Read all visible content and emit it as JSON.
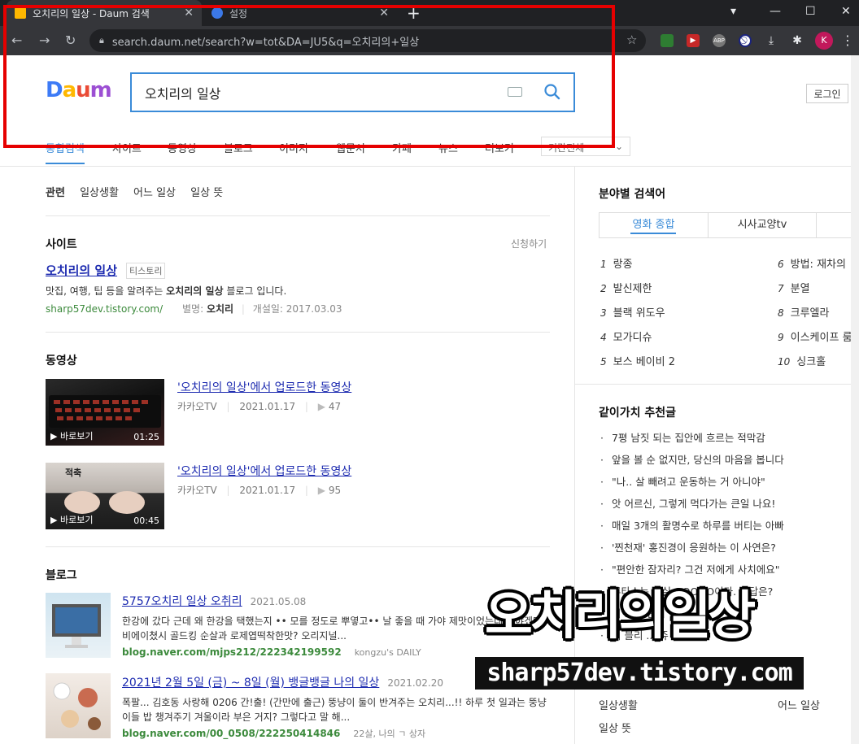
{
  "browser": {
    "tabs": [
      {
        "title": "오치리의 일상 - Daum 검색",
        "active": true
      },
      {
        "title": "설정",
        "active": false
      }
    ],
    "url": "search.daum.net/search?w=tot&DA=JU5&q=오치리의+일상",
    "profile_initial": "K",
    "extensions": [
      "ABP"
    ]
  },
  "header": {
    "logo": [
      "D",
      "a",
      "u",
      "m"
    ],
    "query": "오치리의 일상",
    "login_label": "로그인"
  },
  "gnb": {
    "items": [
      "통합검색",
      "사이트",
      "동영상",
      "블로그",
      "이미지",
      "웹문서",
      "카페",
      "뉴스",
      "더보기"
    ],
    "select_label": "기간전체"
  },
  "related": {
    "label": "관련",
    "items": [
      "일상생활",
      "어느 일상",
      "일상 뜻"
    ]
  },
  "site": {
    "section_title": "사이트",
    "apply_label": "신청하기",
    "title": "오치리의 일상",
    "tag": "티스토리",
    "desc_pre": "맛집, 여행, 팁 등을 알려주는 ",
    "desc_bold": "오치리의 일상",
    "desc_post": " 블로그 입니다.",
    "url": "sharp57dev.tistory.com/",
    "alias_label": "별명:",
    "alias": "오치리",
    "opened": "개설일: 2017.03.03"
  },
  "videos": {
    "section_title": "동영상",
    "items": [
      {
        "title_bold": "'오치리의 일상'",
        "title_rest": "에서 업로드한 동영상",
        "source": "카카오TV",
        "date": "2021.01.17",
        "views": "47",
        "play_label": "바로보기",
        "duration": "01:25"
      },
      {
        "title_bold": "'오치리의 일상'",
        "title_rest": "에서 업로드한 동영상",
        "source": "카카오TV",
        "date": "2021.01.17",
        "views": "95",
        "play_label": "바로보기",
        "duration": "00:45",
        "thumb_text": "적축"
      }
    ]
  },
  "blogs": {
    "section_title": "블로그",
    "items": [
      {
        "title": "5757오치리 일상 오취리",
        "date": "2021.05.08",
        "body": "한강에 갔다 근데 왜 한강을 택했는지 •• 모를 정도로 뿌옇고•• 날 좋을 때 가야 제맛이었는데 가야겠다 비에이쳤시 골드킹 순살과 로제엽떡착한맛? 오리지널...",
        "url": "blog.naver.com/mjps212/222342199592",
        "author": "kongzu's DAILY"
      },
      {
        "title": "2021년 2월 5일 (금) ~ 8일 (월) 뱅글뱅글 나의 일상",
        "date": "2021.02.20",
        "body": "폭팔... 김호동 사랑해  0206 간!출! (간만에 출근) 뚱냥이 둘이 반겨주는 오치리...!!  하루 첫 일과는 뚱냥이들 밥 챙겨주기 겨울이라 부은 거지? 그렇다고 말 해...",
        "url": "blog.naver.com/00_0508/222250414846",
        "author": "22살, 나의 ㄱ 상자"
      }
    ]
  },
  "right": {
    "field_title": "분야별 검색어",
    "tabs": [
      "영화 종합",
      "시사교양tv"
    ],
    "ranks_left": [
      {
        "n": "1",
        "text": "랑종"
      },
      {
        "n": "2",
        "text": "발신제한"
      },
      {
        "n": "3",
        "text": "블랙 위도우"
      },
      {
        "n": "4",
        "text": "모가디슈"
      },
      {
        "n": "5",
        "text": "보스 베이비 2"
      }
    ],
    "ranks_right": [
      {
        "n": "6",
        "text": "방법: 재차의"
      },
      {
        "n": "7",
        "text": "분열"
      },
      {
        "n": "8",
        "text": "크루엘라"
      },
      {
        "n": "9",
        "text": "이스케이프 룸"
      },
      {
        "n": "10",
        "text": "싱크홀"
      }
    ],
    "rec_title": "같이가치 추천글",
    "recs": [
      "7평 남짓 되는 집안에 흐르는 적막감",
      "앞을 볼 순 없지만, 당신의 마음을 봅니다",
      "\"나.. 살 빼려고 운동하는 거 아니야\"",
      "앗 어르신, 그렇게 먹다가는 큰일 나요!",
      "매일 3개의 활명수로 하루를 버티는 아빠",
      "'찐천재' 홍진경이 응원하는 이 사연은?",
      "\"편안한 잠자리? 그건 저에게 사치에요\"",
      "류타스는 사실 OOOOO이다. 정답은?",
      "이 ... 반찬이 이 ...",
      "저 블리 ... 쥬"
    ],
    "related_terms": [
      "일상생활",
      "어느 일상",
      "일상 뜻"
    ]
  },
  "watermark": {
    "title": "오치리의일상",
    "url": "sharp57dev.tistory.com"
  }
}
